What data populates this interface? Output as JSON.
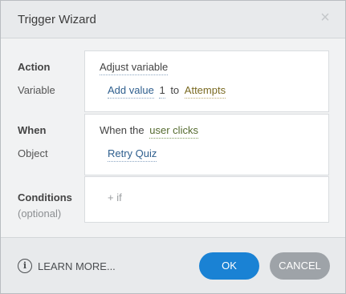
{
  "dialog": {
    "title": "Trigger Wizard",
    "close_symbol": "×"
  },
  "action": {
    "label": "Action",
    "value": "Adjust variable"
  },
  "variable": {
    "label": "Variable",
    "operation": "Add value",
    "amount": "1",
    "connector": "to",
    "target": "Attempts"
  },
  "when": {
    "label": "When",
    "prefix": "When the",
    "event": "user clicks"
  },
  "object": {
    "label": "Object",
    "value": "Retry Quiz"
  },
  "conditions": {
    "label": "Conditions",
    "sublabel": "(optional)",
    "add_if": "+ if"
  },
  "footer": {
    "learn_more": "LEARN MORE...",
    "info_icon_glyph": "i",
    "ok_label": "OK",
    "cancel_label": "CANCEL"
  },
  "colors": {
    "ok_button": "#1a82d4",
    "cancel_button": "#9ea3a8",
    "link_blue": "#2f5f8e",
    "variable_gold": "#7a6a22"
  }
}
